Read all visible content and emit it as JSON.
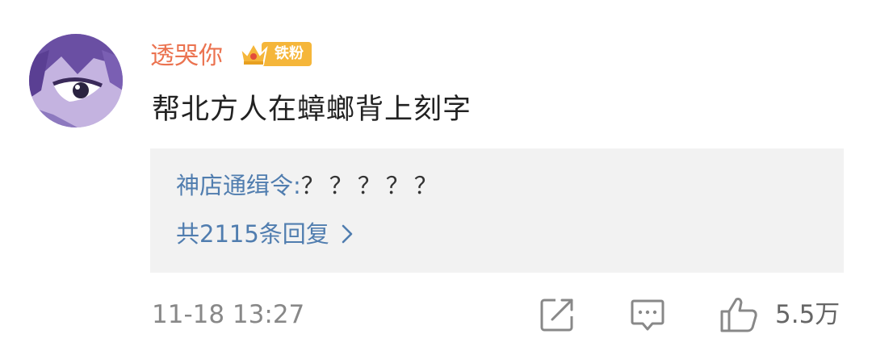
{
  "comment": {
    "username": "透哭你",
    "badge": {
      "label": "铁粉",
      "icon": "crown-badge-icon",
      "color": "#f5b63a"
    },
    "text": "帮北方人在蟑螂背上刻字",
    "reply_preview": {
      "author": "神店通缉令",
      "separator": ":",
      "content": "？？？？？",
      "more_label": "共2115条回复"
    },
    "timestamp": "11-18 13:27",
    "actions": {
      "share_icon": "share-icon",
      "comment_icon": "comment-icon",
      "like_icon": "thumbs-up-icon",
      "like_count": "5.5万"
    },
    "colors": {
      "username": "#eb7350",
      "link": "#507daf",
      "reply_background": "#f2f2f2"
    }
  }
}
